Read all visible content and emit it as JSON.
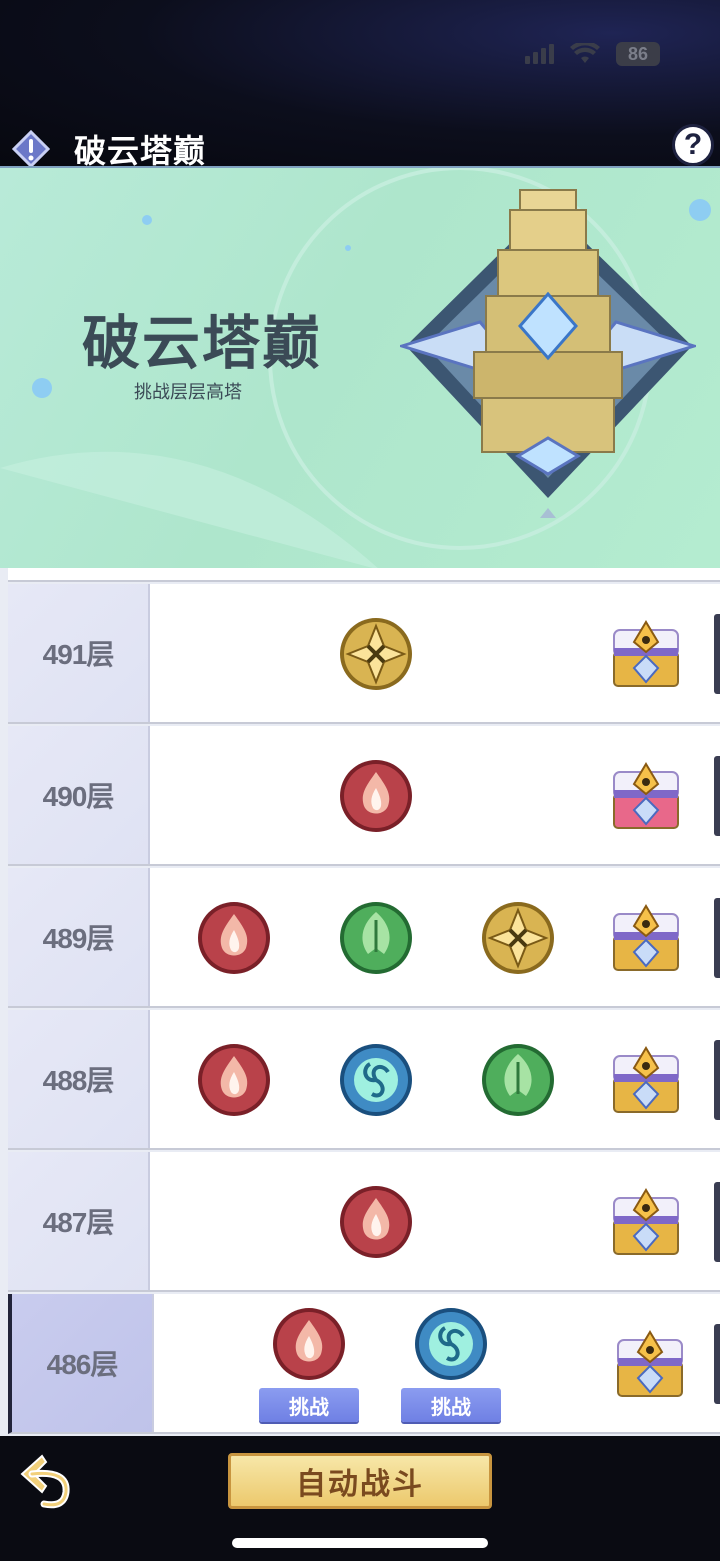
{
  "status_bar": {
    "battery": "86"
  },
  "header": {
    "title": "破云塔巅"
  },
  "banner": {
    "title": "破云塔巅",
    "subtitle": "挑战层层高塔"
  },
  "floors": [
    {
      "label": "491层",
      "enemies": [
        "light-element"
      ],
      "reward": "gold-chest",
      "active": false
    },
    {
      "label": "490层",
      "enemies": [
        "fire-element"
      ],
      "reward": "pink-chest",
      "active": false
    },
    {
      "label": "489层",
      "enemies": [
        "fire-element",
        "nature-element",
        "light-element"
      ],
      "reward": "gold-chest",
      "active": false
    },
    {
      "label": "488层",
      "enemies": [
        "fire-element",
        "wind-element",
        "nature-element"
      ],
      "reward": "gold-chest",
      "active": false
    },
    {
      "label": "487层",
      "enemies": [
        "fire-element"
      ],
      "reward": "gold-chest",
      "active": false
    },
    {
      "label": "486层",
      "enemies": [
        "fire-element",
        "wind-element"
      ],
      "reward": "gold-chest",
      "active": true,
      "challenge_labels": [
        "挑战",
        "挑战"
      ]
    }
  ],
  "footer": {
    "auto_battle_label": "自动战斗"
  },
  "colors": {
    "fire": "#a8343c",
    "nature": "#3e9d4c",
    "light": "#c9a240",
    "wind": "#2c6fa4",
    "accent_button": "#7585e8",
    "auto_button": "#efcf7a"
  }
}
